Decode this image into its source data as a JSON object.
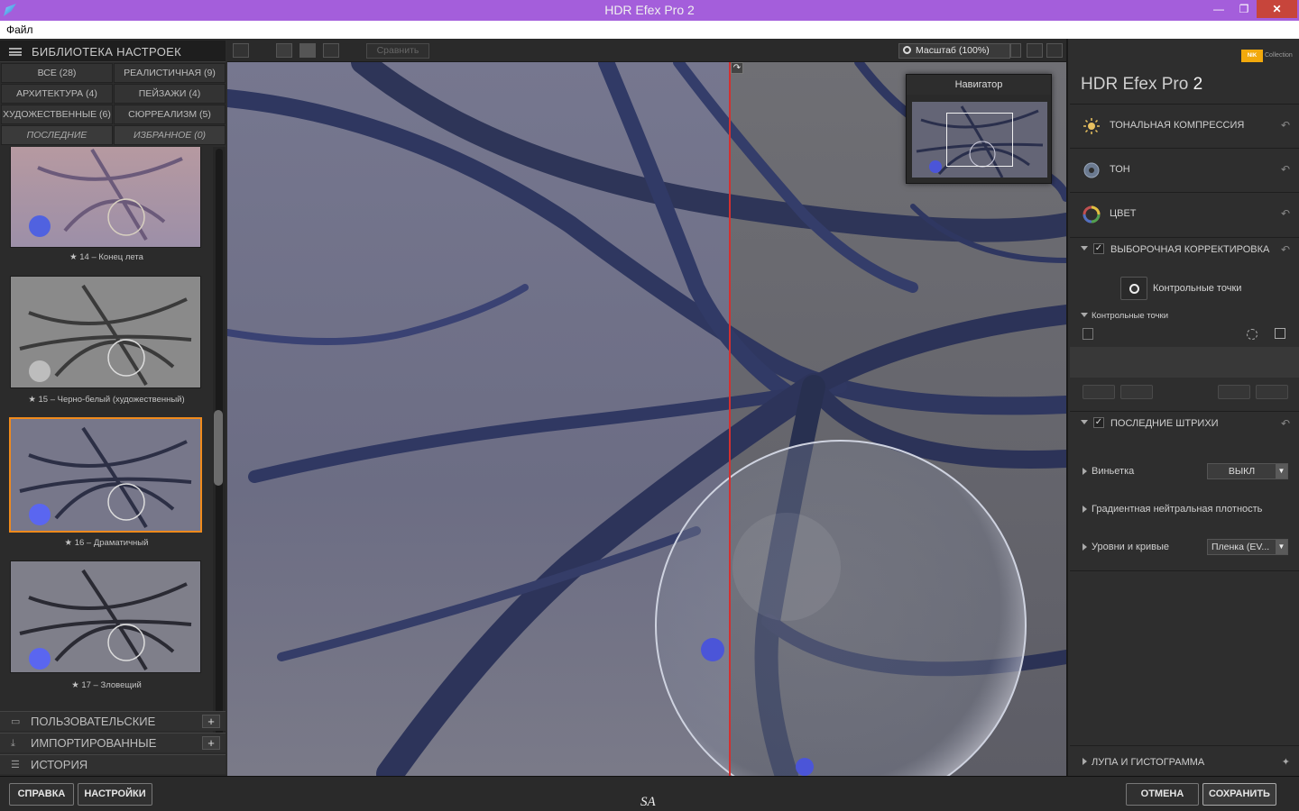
{
  "window": {
    "title": "HDR Efex Pro 2",
    "minimize": "—",
    "maximize": "❐",
    "close": "✕"
  },
  "menu": {
    "file": "Файл"
  },
  "library": {
    "title": "БИБЛИОТЕКА НАСТРОЕК",
    "categories": [
      {
        "label": "ВСЕ (28)"
      },
      {
        "label": "РЕАЛИСТИЧНАЯ (9)"
      },
      {
        "label": "АРХИТЕКТУРА (4)"
      },
      {
        "label": "ПЕЙЗАЖИ (4)"
      },
      {
        "label": "ХУДОЖЕСТВЕННЫЕ (6)"
      },
      {
        "label": "СЮРРЕАЛИЗМ (5)"
      },
      {
        "label": "ПОСЛЕДНИЕ"
      },
      {
        "label": "ИЗБРАННОЕ (0)"
      }
    ],
    "presets": [
      {
        "label": "★ 14 – Конец лета"
      },
      {
        "label": "★ 15 – Черно-белый (художественный)"
      },
      {
        "label": "★ 16 – Драматичный"
      },
      {
        "label": "★ 17 – Зловещий"
      }
    ],
    "custom": "ПОЛЬЗОВАТЕЛЬСКИЕ",
    "imported": "ИМПОРТИРОВАННЫЕ",
    "history": "ИСТОРИЯ",
    "plus": "+"
  },
  "toolbar": {
    "compare": "Сравнить",
    "zoom": "Масштаб (100%)"
  },
  "navigator": {
    "title": "Навигатор"
  },
  "right": {
    "brand": "NIK",
    "collection": "Collection",
    "app_name": "HDR Efex Pro",
    "app_version": "2",
    "tone_compression": "ТОНАЛЬНАЯ КОМПРЕССИЯ",
    "tone": "ТОН",
    "color": "ЦВЕТ",
    "selective": "ВЫБОРОЧНАЯ КОРРЕКТИРОВКА",
    "control_points_btn": "Контрольные точки",
    "control_points_sub": "Контрольные точки",
    "finishing": "ПОСЛЕДНИЕ ШТРИХИ",
    "vignette": "Виньетка",
    "vignette_value": "ВЫКЛ",
    "gnd": "Градиентная нейтральная плотность",
    "levels": "Уровни и кривые",
    "levels_value": "Пленка (EV...",
    "loupe": "ЛУПА И ГИСТОГРАММА",
    "checkmark": "✓",
    "undo": "↶"
  },
  "bottom": {
    "help": "СПРАВКА",
    "settings": "НАСТРОЙКИ",
    "cancel": "ОТМЕНА",
    "save": "СОХРАНИТЬ",
    "watermark": "SA"
  },
  "colors": {
    "title_bar": "#a45edb",
    "selection": "#f08a1c",
    "split": "#d23030"
  }
}
